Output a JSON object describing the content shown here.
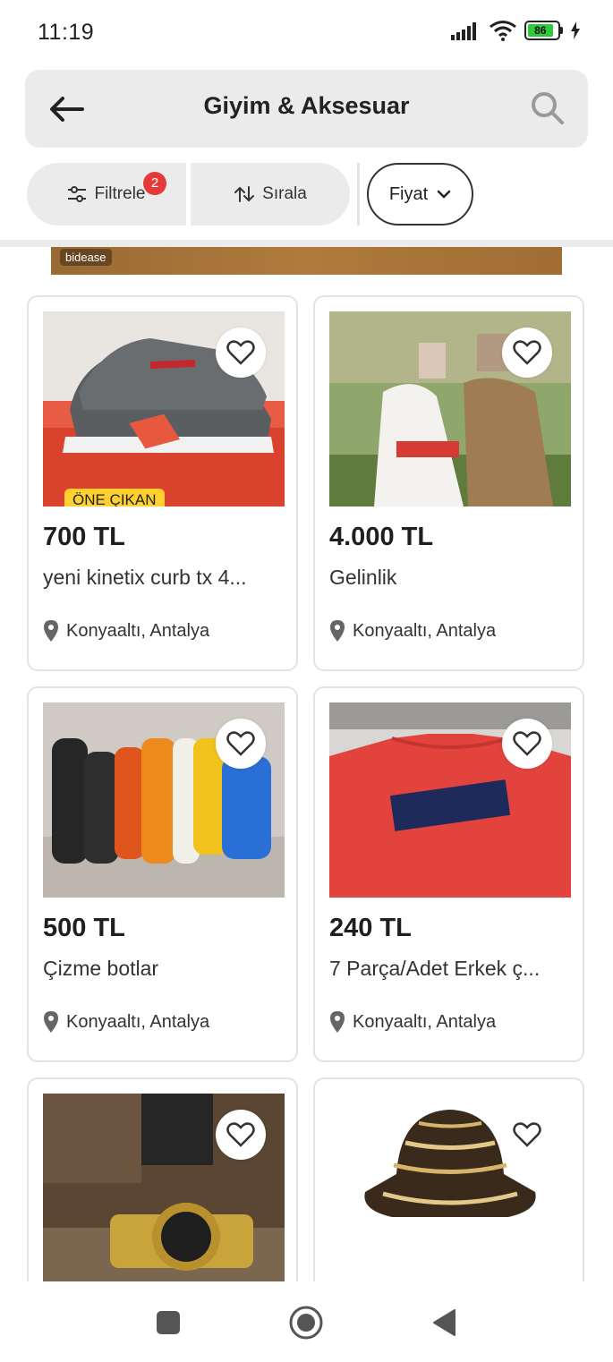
{
  "status": {
    "time": "11:19",
    "battery": "86"
  },
  "header": {
    "title": "Giyim & Aksesuar"
  },
  "filters": {
    "filter_label": "Filtrele",
    "filter_badge": "2",
    "sort_label": "Sırala",
    "price_label": "Fiyat"
  },
  "banner": {
    "brand": "bidease"
  },
  "listings": [
    {
      "price": "700 TL",
      "title": "yeni kinetix curb tx 4...",
      "location": "Konyaaltı, Antalya",
      "badge": "ÖNE ÇIKAN"
    },
    {
      "price": "4.000 TL",
      "title": "Gelinlik",
      "location": "Konyaaltı, Antalya"
    },
    {
      "price": "500 TL",
      "title": "Çizme botlar",
      "location": "Konyaaltı, Antalya"
    },
    {
      "price": "240 TL",
      "title": "7 Parça/Adet Erkek ç...",
      "location": "Konyaaltı, Antalya"
    }
  ],
  "colors": {
    "accent_badge": "#e63a3a",
    "featured": "#ffd12e",
    "chip_bg": "#ebebeb"
  }
}
